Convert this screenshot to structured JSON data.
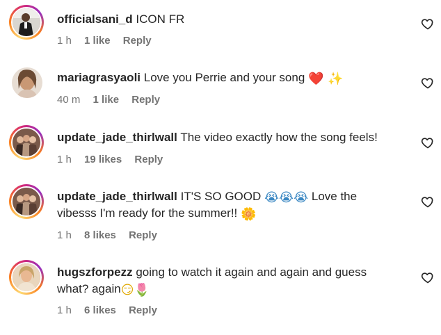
{
  "comments": [
    {
      "username": "officialsani_d",
      "text": "ICON FR",
      "emoji": "",
      "time": "1 h",
      "likes": "1 like",
      "reply": "Reply"
    },
    {
      "username": "mariagrasyaoli",
      "text": "Love you Perrie and your song",
      "emoji": "❤️ ✨",
      "time": "40 m",
      "likes": "1 like",
      "reply": "Reply"
    },
    {
      "username": "update_jade_thirlwall",
      "text": "The video exactly how the song feels!",
      "emoji": "",
      "time": "1 h",
      "likes": "19 likes",
      "reply": "Reply"
    },
    {
      "username": "update_jade_thirlwall",
      "text_before": "IT'S SO GOOD",
      "emoji_mid": "😭😭😭",
      "text_after": "Love the vibesss I'm ready for the summer!!",
      "emoji": "🌼",
      "time": "1 h",
      "likes": "8 likes",
      "reply": "Reply"
    },
    {
      "username": "hugszforpezz",
      "text": "going to watch it again and again and guess what? again",
      "emoji": "😏🌷",
      "time": "1 h",
      "likes": "6 likes",
      "reply": "Reply"
    }
  ],
  "icons": {
    "like": "heart-outline-icon"
  },
  "colors": {
    "text": "#262626",
    "meta": "#737373",
    "story_ring": "#d62976"
  }
}
